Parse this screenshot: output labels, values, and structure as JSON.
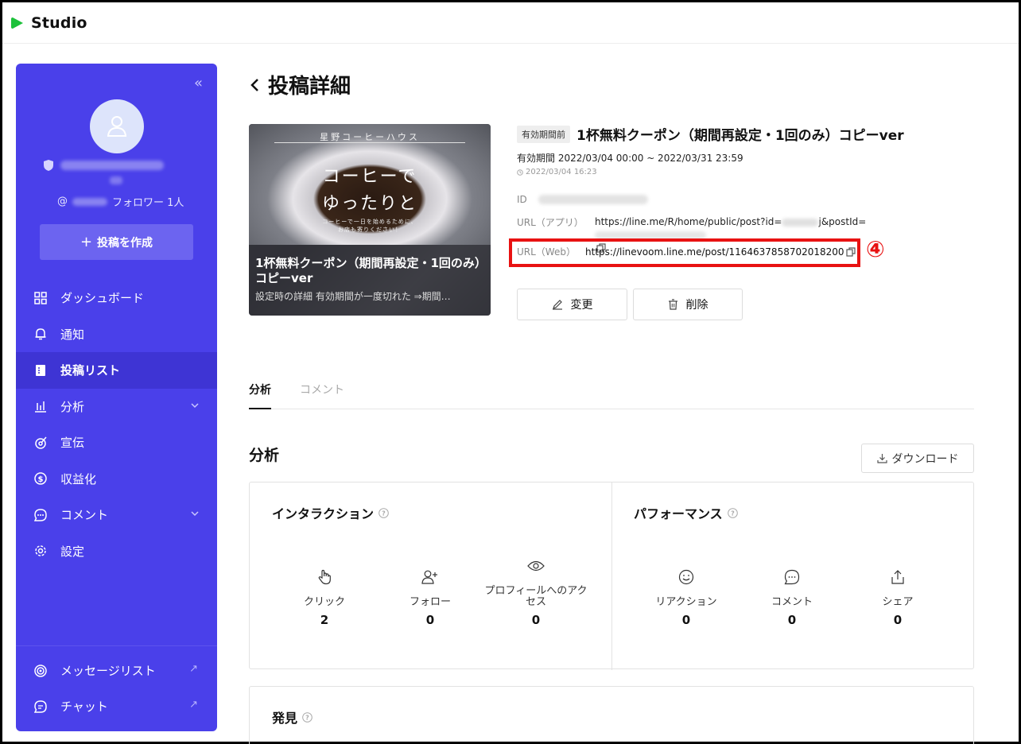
{
  "app": {
    "name": "Studio",
    "brand_color": "#1DC13B"
  },
  "sidebar": {
    "bg_color": "#4A40EA",
    "handle_prefix": "@",
    "followers": "フォロワー 1人",
    "create_button": "投稿を作成",
    "nav": [
      {
        "label": "ダッシュボード",
        "icon": "grid-icon"
      },
      {
        "label": "通知",
        "icon": "bell-icon"
      },
      {
        "label": "投稿リスト",
        "icon": "document-icon",
        "active": true
      },
      {
        "label": "分析",
        "icon": "bar-chart-icon",
        "expandable": true
      },
      {
        "label": "宣伝",
        "icon": "target-icon"
      },
      {
        "label": "収益化",
        "icon": "dollar-icon"
      },
      {
        "label": "コメント",
        "icon": "chat-icon",
        "expandable": true
      },
      {
        "label": "設定",
        "icon": "gear-icon"
      }
    ],
    "bottom_nav": [
      {
        "label": "メッセージリスト",
        "icon": "broadcast-icon"
      },
      {
        "label": "チャット",
        "icon": "chat-bubble-icon"
      }
    ]
  },
  "page": {
    "title": "投稿詳細"
  },
  "thumbnail": {
    "brand": "星野コーヒーハウス",
    "catch1": "コーヒーで",
    "catch2": "ゆったりと",
    "small1": "コーヒーで一日を始めるために、",
    "small2": "お店も寄りください！",
    "title": "1杯無料クーポン（期間再設定・1回のみ）コピーver",
    "description": "設定時の詳細 有効期間が一度切れた ⇒期間…"
  },
  "post": {
    "status_badge": "有効期間前",
    "title": "1杯無料クーポン（期間再設定・1回のみ）コピーver",
    "period": "有効期間 2022/03/04 00:00 ~ 2022/03/31 23:59",
    "created": "2022/03/04 16:23",
    "id_label": "ID",
    "url_app_label": "URL（アプリ）",
    "url_app_part1": "https://line.me/R/home/public/post?id=",
    "url_app_part2": "j&postId=",
    "url_web_label": "URL（Web）",
    "url_web": "https://linevoom.line.me/post/1164637858702018200",
    "annotation_marker": "④",
    "highlight_color": "#E81212"
  },
  "actions": {
    "edit": "変更",
    "delete": "削除"
  },
  "tabs": [
    {
      "label": "分析",
      "active": true
    },
    {
      "label": "コメント",
      "active": false
    }
  ],
  "analysis": {
    "title": "分析",
    "download": "ダウンロード",
    "interaction": {
      "title": "インタラクション",
      "metrics": [
        {
          "label": "クリック",
          "value": "2",
          "icon": "hand-pointer-icon"
        },
        {
          "label": "フォロー",
          "value": "0",
          "icon": "person-add-icon"
        },
        {
          "label": "プロフィールへのアクセス",
          "value": "0",
          "icon": "eye-icon"
        }
      ]
    },
    "performance": {
      "title": "パフォーマンス",
      "metrics": [
        {
          "label": "リアクション",
          "value": "0",
          "icon": "smile-icon"
        },
        {
          "label": "コメント",
          "value": "0",
          "icon": "comment-icon"
        },
        {
          "label": "シェア",
          "value": "0",
          "icon": "share-icon"
        }
      ]
    },
    "discovery": {
      "title": "発見"
    }
  }
}
